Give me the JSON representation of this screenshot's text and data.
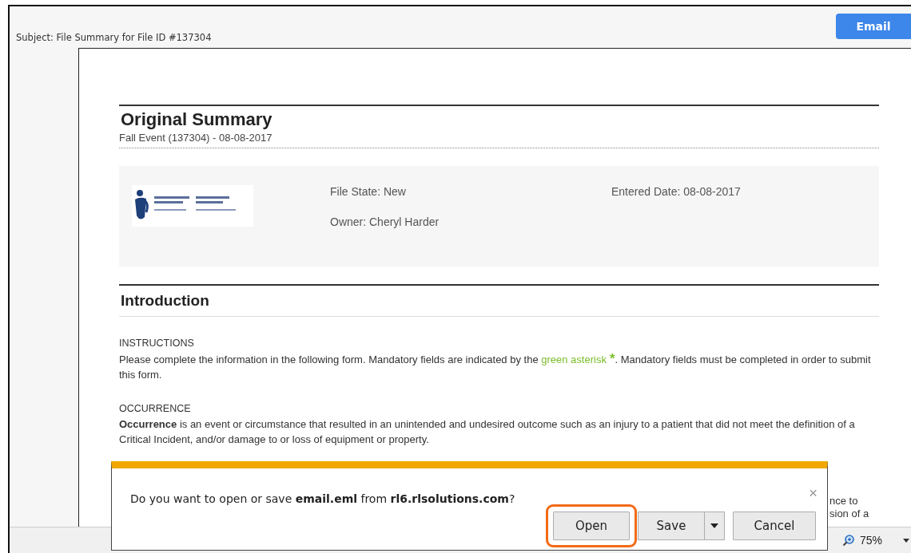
{
  "subject": "Subject: File Summary for File ID #137304",
  "email_button": "Email",
  "summary": {
    "title": "Original Summary",
    "subtitle": "Fall Event (137304) - 08-08-2017",
    "file_state": "File State: New",
    "owner": "Owner: Cheryl Harder",
    "entered_date": "Entered Date: 08-08-2017"
  },
  "introduction": {
    "title": "Introduction",
    "sections": [
      {
        "heading": "INSTRUCTIONS",
        "parts": [
          {
            "kind": "plain",
            "text": "Please complete the information in the following form. Mandatory fields are indicated by the "
          },
          {
            "kind": "green",
            "text": "green asterisk"
          },
          {
            "kind": "star",
            "text": "*"
          },
          {
            "kind": "plain",
            "text": ". Mandatory fields must be completed in order to submit this form."
          }
        ]
      },
      {
        "heading": "OCCURRENCE",
        "parts": [
          {
            "kind": "rich",
            "text": "**Occurrence** is an event or circumstance that resulted in an unintended and undesired outcome such as an injury to a patient that did not meet the definition of a Critical Incident, and/or damage to or loss of equipment or property."
          }
        ]
      }
    ]
  },
  "covered_text": [
    "nce to",
    "sion of a"
  ],
  "status_bar": {
    "zoom": "75%"
  },
  "download_bar": {
    "message": "Do you want to open or save **email.eml** from **rl6.rlsolutions.com**?",
    "close": "×",
    "buttons": [
      {
        "label": "Open",
        "kind": "plain",
        "highlighted": true
      },
      {
        "label": "Save",
        "kind": "split",
        "highlighted": false
      },
      {
        "label": "Cancel",
        "kind": "plain",
        "highlighted": false
      }
    ]
  }
}
